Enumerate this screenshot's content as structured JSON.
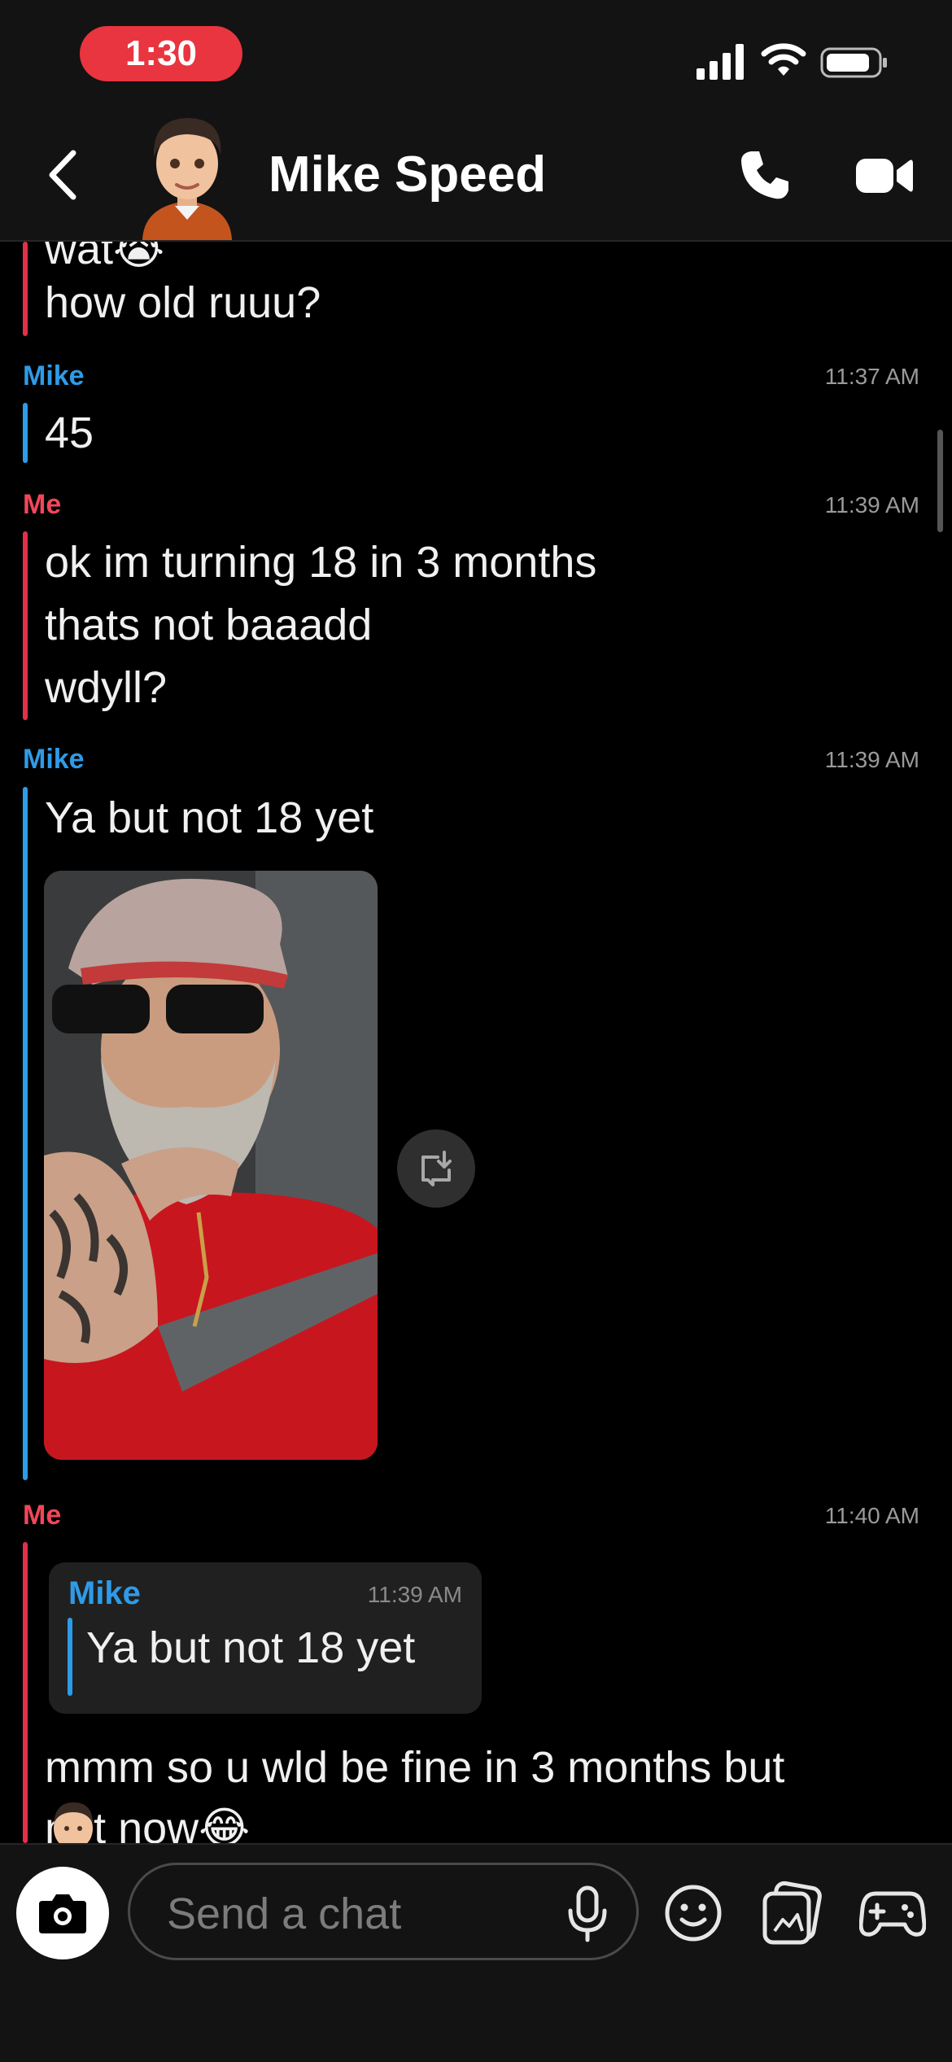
{
  "status_bar": {
    "time": "1:30"
  },
  "header": {
    "title": "Mike Speed"
  },
  "messages": [
    {
      "sender": "",
      "time": "",
      "lines": [
        "wat😭",
        "how old ruuu?"
      ]
    },
    {
      "sender": "Mike",
      "time": "11:37 AM",
      "lines": [
        "45"
      ]
    },
    {
      "sender": "Me",
      "time": "11:39 AM",
      "lines": [
        "ok im turning 18 in 3 months",
        "thats not baaadd",
        "wdyll?"
      ]
    },
    {
      "sender": "Mike",
      "time": "11:39 AM",
      "lines": [
        "Ya but not 18 yet"
      ],
      "attachment": "photo"
    },
    {
      "sender": "Me",
      "time": "11:40 AM",
      "reply_to": {
        "sender": "Mike",
        "time": "11:39 AM",
        "text": "Ya but not 18 yet"
      },
      "lines": [
        "mmm so u wld be fine in 3 months but",
        "not now😂"
      ]
    }
  ],
  "composer": {
    "placeholder": "Send a chat"
  },
  "icons": {
    "back": "chevron-left-icon",
    "call": "phone-icon",
    "video": "video-camera-icon",
    "camera": "camera-icon",
    "mic": "microphone-icon",
    "emoji": "smiley-icon",
    "memories": "memories-icon",
    "games": "gamepad-icon",
    "save": "save-to-chat-icon"
  },
  "colors": {
    "me": "#e0304a",
    "mike": "#2e9be8",
    "time_pill": "#e8353f",
    "background": "#000000",
    "bar": "#131313"
  }
}
